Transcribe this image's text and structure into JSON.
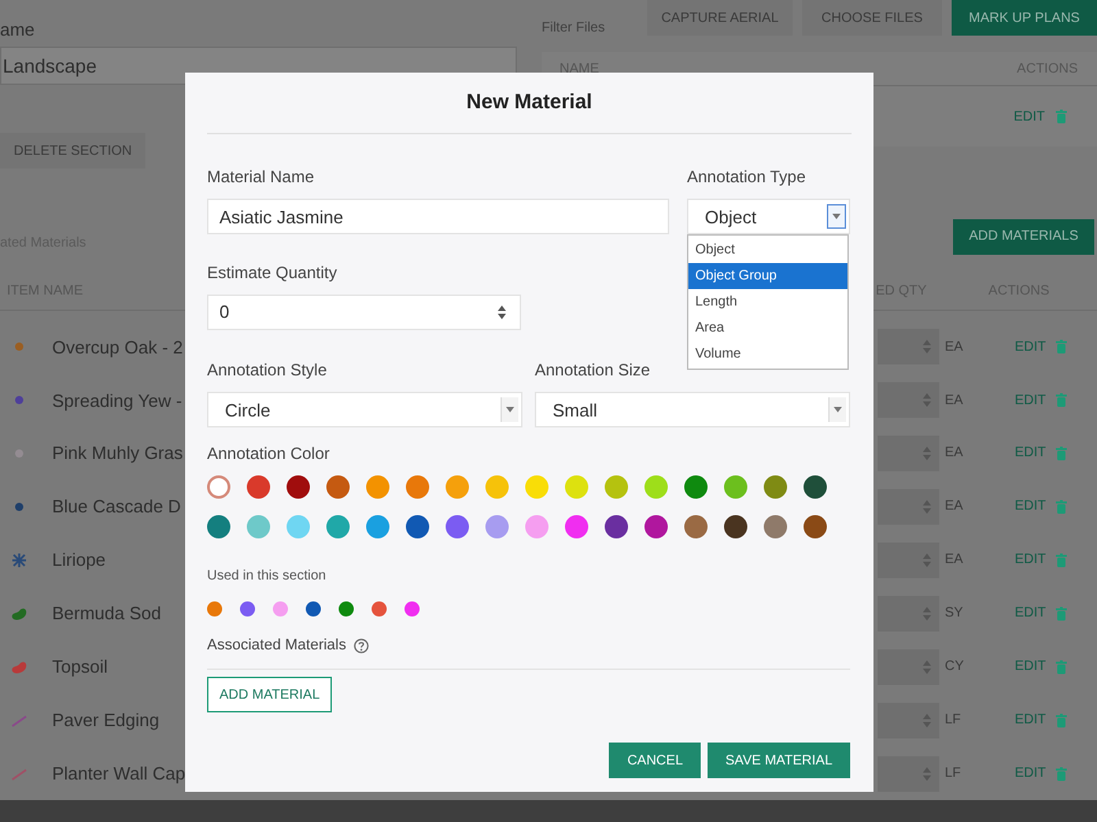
{
  "page": {
    "name_label": "ame",
    "name_value": "Landscape",
    "delete_button": "DELETE SECTION",
    "filter_label": "Filter Files",
    "file_buttons": [
      {
        "label": "CAPTURE AERIAL",
        "kind": "plain"
      },
      {
        "label": "CHOOSE FILES",
        "kind": "plain"
      },
      {
        "label": "MARK UP PLANS",
        "kind": "primary"
      }
    ],
    "files_table": {
      "columns": [
        "NAME",
        "ACTIONS"
      ],
      "rows": [
        {
          "action": "EDIT"
        }
      ]
    },
    "materials_label": "ated Materials",
    "add_materials_button": "ADD MATERIALS",
    "materials_table": {
      "columns": [
        "ITEM NAME",
        "ED QTY",
        "ACTIONS"
      ],
      "rows": [
        {
          "name": "Overcup Oak - 2",
          "kind": "dot",
          "color": "#9a5e22",
          "unit": "EA",
          "action": "EDIT"
        },
        {
          "name": "Spreading Yew -",
          "kind": "dot",
          "color": "#4e3f9a",
          "unit": "EA",
          "action": "EDIT"
        },
        {
          "name": "Pink Muhly Gras",
          "kind": "dot",
          "color": "#948c92",
          "unit": "EA",
          "action": "EDIT"
        },
        {
          "name": "Blue Cascade D",
          "kind": "dot",
          "color": "#1f3f6a",
          "unit": "EA",
          "action": "EDIT"
        },
        {
          "name": "Liriope",
          "kind": "pattern",
          "color": "#294a78",
          "unit": "EA",
          "action": "EDIT"
        },
        {
          "name": "Bermuda Sod",
          "kind": "area",
          "color": "#236b23",
          "unit": "SY",
          "action": "EDIT"
        },
        {
          "name": "Topsoil",
          "kind": "area",
          "color": "#b83a3a",
          "unit": "CY",
          "action": "EDIT"
        },
        {
          "name": "Paver Edging",
          "kind": "line",
          "color": "#8a4a8a",
          "unit": "LF",
          "action": "EDIT"
        },
        {
          "name": "Planter Wall Cap",
          "kind": "line",
          "color": "#a05066",
          "unit": "LF",
          "action": "EDIT"
        }
      ]
    }
  },
  "dialog": {
    "title": "New Material",
    "material_name": {
      "label": "Material Name",
      "value": "Asiatic Jasmine"
    },
    "annotation_type": {
      "label": "Annotation Type",
      "value": "Object",
      "expanded": true,
      "options": [
        {
          "label": "Object",
          "highlighted": false
        },
        {
          "label": "Object Group",
          "highlighted": true
        },
        {
          "label": "Length",
          "highlighted": false
        },
        {
          "label": "Area",
          "highlighted": false
        },
        {
          "label": "Volume",
          "highlighted": false
        }
      ]
    },
    "estimate_quantity": {
      "label": "Estimate Quantity",
      "value": "0"
    },
    "annotation_style": {
      "label": "Annotation Style",
      "value": "Circle"
    },
    "annotation_size": {
      "label": "Annotation Size",
      "value": "Small"
    },
    "annotation_color": {
      "label": "Annotation Color",
      "swatches": [
        {
          "color": "#ffffff",
          "selected": true
        },
        {
          "color": "#d93a2b",
          "selected": false
        },
        {
          "color": "#a00d0d",
          "selected": false
        },
        {
          "color": "#c55a11",
          "selected": false
        },
        {
          "color": "#f39200",
          "selected": false
        },
        {
          "color": "#e8780a",
          "selected": false
        },
        {
          "color": "#f5a00c",
          "selected": false
        },
        {
          "color": "#f6c20a",
          "selected": false
        },
        {
          "color": "#f9dd07",
          "selected": false
        },
        {
          "color": "#dde10f",
          "selected": false
        },
        {
          "color": "#b5c20f",
          "selected": false
        },
        {
          "color": "#9ede1a",
          "selected": false
        },
        {
          "color": "#0f8a0f",
          "selected": false
        },
        {
          "color": "#6cbf1e",
          "selected": false
        },
        {
          "color": "#7f8b14",
          "selected": false
        },
        {
          "color": "#1f4f3a",
          "selected": false
        },
        {
          "color": "#147f7f",
          "selected": false
        },
        {
          "color": "#6ec9c9",
          "selected": false
        },
        {
          "color": "#6fd6f2",
          "selected": false
        },
        {
          "color": "#20a8a8",
          "selected": false
        },
        {
          "color": "#1aa0e0",
          "selected": false
        },
        {
          "color": "#1159b3",
          "selected": false
        },
        {
          "color": "#7b5cf2",
          "selected": false
        },
        {
          "color": "#a79cf0",
          "selected": false
        },
        {
          "color": "#f59ef0",
          "selected": false
        },
        {
          "color": "#f02ef0",
          "selected": false
        },
        {
          "color": "#6a2fa0",
          "selected": false
        },
        {
          "color": "#b0179e",
          "selected": false
        },
        {
          "color": "#9a6a44",
          "selected": false
        },
        {
          "color": "#4a3420",
          "selected": false
        },
        {
          "color": "#8f7a6a",
          "selected": false
        },
        {
          "color": "#8a4a16",
          "selected": false
        }
      ]
    },
    "used_label": "Used in this section",
    "used_colors": [
      {
        "color": "#e8780a"
      },
      {
        "color": "#7b5cf2"
      },
      {
        "color": "#f59ef0"
      },
      {
        "color": "#1159b3"
      },
      {
        "color": "#0f8a0f"
      },
      {
        "color": "#e5533d"
      },
      {
        "color": "#f02ef0"
      }
    ],
    "associated_label": "Associated Materials",
    "add_material_button": "ADD MATERIAL",
    "buttons": [
      {
        "label": "CANCEL"
      },
      {
        "label": "SAVE MATERIAL"
      }
    ]
  }
}
